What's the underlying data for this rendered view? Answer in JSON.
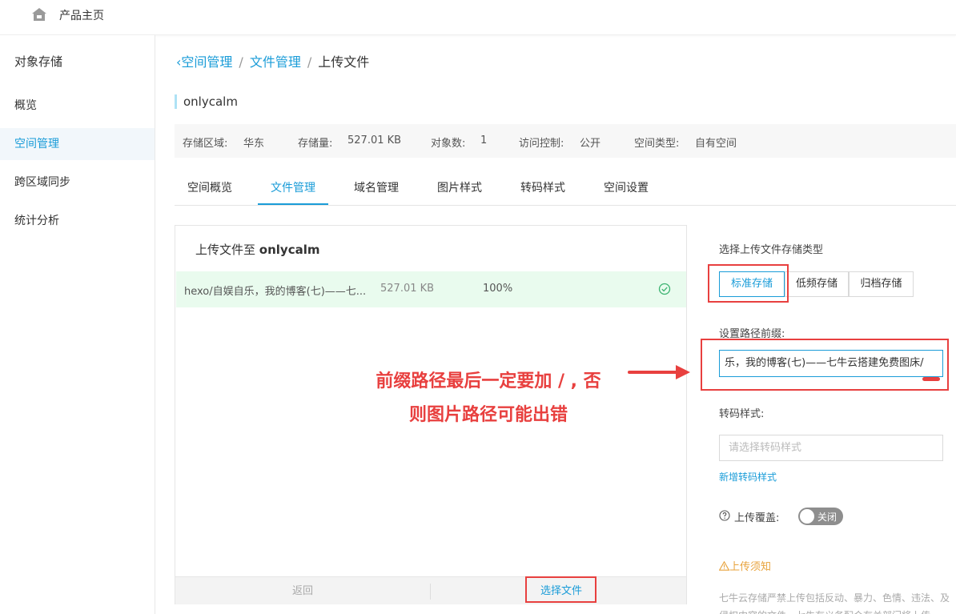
{
  "topbar": {
    "home_label": "产品主页",
    "icon": "home-icon"
  },
  "sidebar": {
    "title": "对象存储",
    "items": [
      {
        "label": "概览",
        "active": false
      },
      {
        "label": "空间管理",
        "active": true
      },
      {
        "label": "跨区域同步",
        "active": false
      },
      {
        "label": "统计分析",
        "active": false
      }
    ]
  },
  "breadcrumb": {
    "items": [
      "空间管理",
      "文件管理",
      "上传文件"
    ],
    "separator": "/"
  },
  "bucket": {
    "name": "onlycalm"
  },
  "info": {
    "region_label": "存储区域:",
    "region_value": "华东",
    "storage_label": "存储量:",
    "storage_value": "527.01 KB",
    "objects_label": "对象数:",
    "objects_value": "1",
    "access_label": "访问控制:",
    "access_value": "公开",
    "type_label": "空间类型:",
    "type_value": "自有空间"
  },
  "tabs": [
    {
      "label": "空间概览",
      "active": false
    },
    {
      "label": "文件管理",
      "active": true
    },
    {
      "label": "域名管理",
      "active": false
    },
    {
      "label": "图片样式",
      "active": false
    },
    {
      "label": "转码样式",
      "active": false
    },
    {
      "label": "空间设置",
      "active": false
    }
  ],
  "upload": {
    "title_prefix": "上传文件至",
    "title_bucket": "onlycalm",
    "file": {
      "name": "hexo/自娱自乐，我的博客(七)——七...",
      "size": "527.01 KB",
      "progress": "100%",
      "status_icon": "check-circle-icon"
    },
    "back_label": "返回",
    "choose_label": "选择文件"
  },
  "settings": {
    "storage_type_label": "选择上传文件存储类型",
    "storage_types": [
      {
        "label": "标准存储",
        "active": true
      },
      {
        "label": "低频存储",
        "active": false
      },
      {
        "label": "归档存储",
        "active": false
      }
    ],
    "prefix_label": "设置路径前缀:",
    "prefix_value": "乐，我的博客(七)——七牛云搭建免费图床/",
    "transcode_label": "转码样式:",
    "transcode_placeholder": "请选择转码样式",
    "add_transcode_label": "新增转码样式",
    "overwrite_label": "上传覆盖:",
    "overwrite_state": "关闭",
    "notice_title": "上传须知",
    "notice_body": "七牛云存储严禁上传包括反动、暴力、色情、违法、及侵权内容的文件。七牛有义务配合有关部门将上传"
  },
  "annotation": {
    "line1": "前缀路径最后一定要加 / , 否",
    "line2": "则图片路径可能出错",
    "color": "#e8403f"
  },
  "colors": {
    "accent": "#1a9cd8",
    "success_bg": "#e9fbee",
    "warning": "#e8a33d"
  }
}
